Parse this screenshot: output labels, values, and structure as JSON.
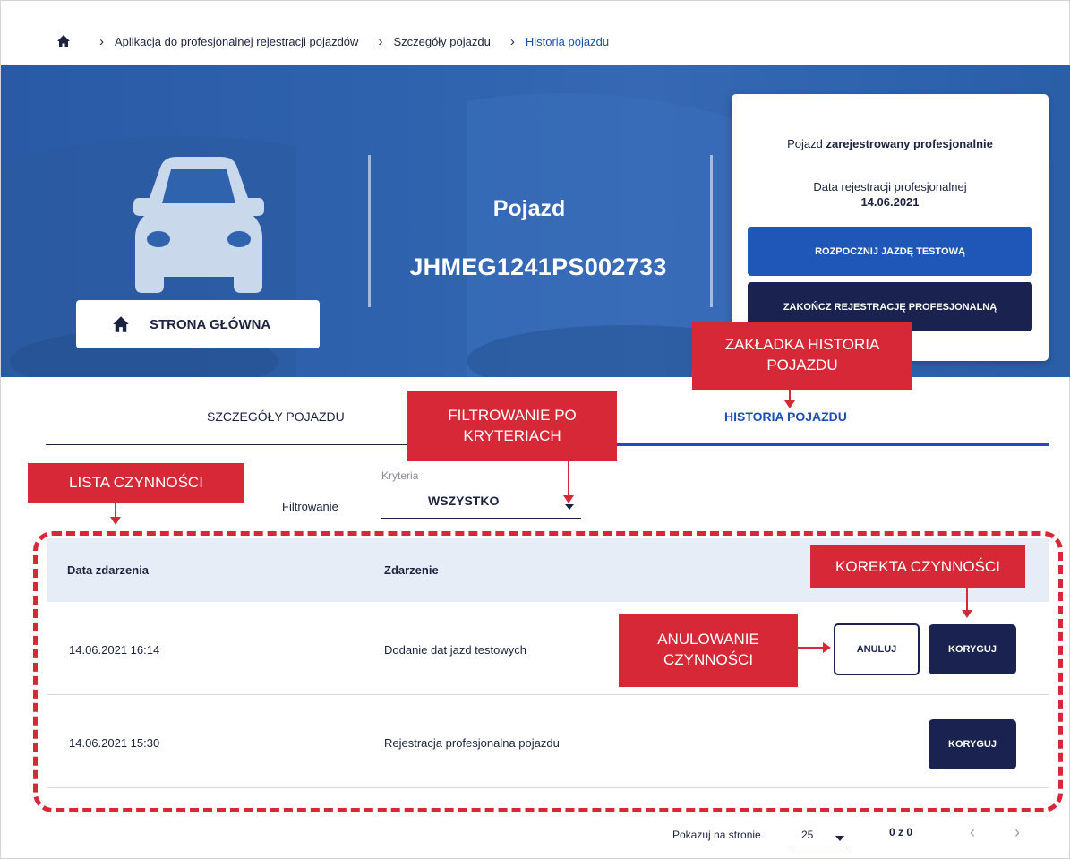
{
  "breadcrumb": {
    "home_icon": "home-icon",
    "items": [
      "Aplikacja do profesjonalnej rejestracji pojazdów",
      "Szczegóły pojazdu",
      "Historia pojazdu"
    ]
  },
  "hero": {
    "vehicle_icon": "car-icon",
    "vehicle_label": "Pojazd",
    "vin": "JHMEG1241PS002733",
    "home_button_label": "STRONA GŁÓWNA",
    "status_prefix": "Pojazd ",
    "status_bold": "zarejestrowany profesjonalnie",
    "reg_date_label": "Data rejestracji profesjonalnej",
    "reg_date": "14.06.2021",
    "start_test_button": "ROZPOCZNIJ JAZDĘ TESTOWĄ",
    "end_registration_button": "ZAKOŃCZ REJESTRACJĘ PROFESJONALNĄ"
  },
  "tabs": {
    "details": "SZCZEGÓŁY POJAZDU",
    "history": "HISTORIA POJAZDU",
    "active": "history"
  },
  "filter": {
    "label": "Filtrowanie",
    "criteria_label": "Kryteria",
    "selected": "WSZYSTKO"
  },
  "table": {
    "headers": [
      "Data zdarzenia",
      "Zdarzenie"
    ],
    "rows": [
      {
        "date": "14.06.2021 16:14",
        "event": "Dodanie dat jazd testowych",
        "cancel": "ANULUJ",
        "correct": "KORYGUJ"
      },
      {
        "date": "14.06.2021 15:30",
        "event": "Rejestracja profesjonalna pojazdu",
        "correct": "KORYGUJ"
      }
    ]
  },
  "pagination": {
    "per_page_label": "Pokazuj na stronie",
    "per_page": "25",
    "count": "0 z 0",
    "prev_icon": "chevron-left-icon",
    "next_icon": "chevron-right-icon"
  },
  "annotations": {
    "history_tab": "ZAKŁADKA HISTORIA POJAZDU",
    "filter": "FILTROWANIE PO KRYTERIACH",
    "list": "LISTA CZYNNOŚCI",
    "correct": "KOREKTA CZYNNOŚCI",
    "cancel": "ANULOWANIE CZYNNOŚCI"
  },
  "colors": {
    "annotation_red": "#d62836",
    "navy": "#1a2350",
    "primary_blue": "#1e57b8",
    "link_blue": "#1e4fb0",
    "table_header_bg": "#e7edf6"
  }
}
